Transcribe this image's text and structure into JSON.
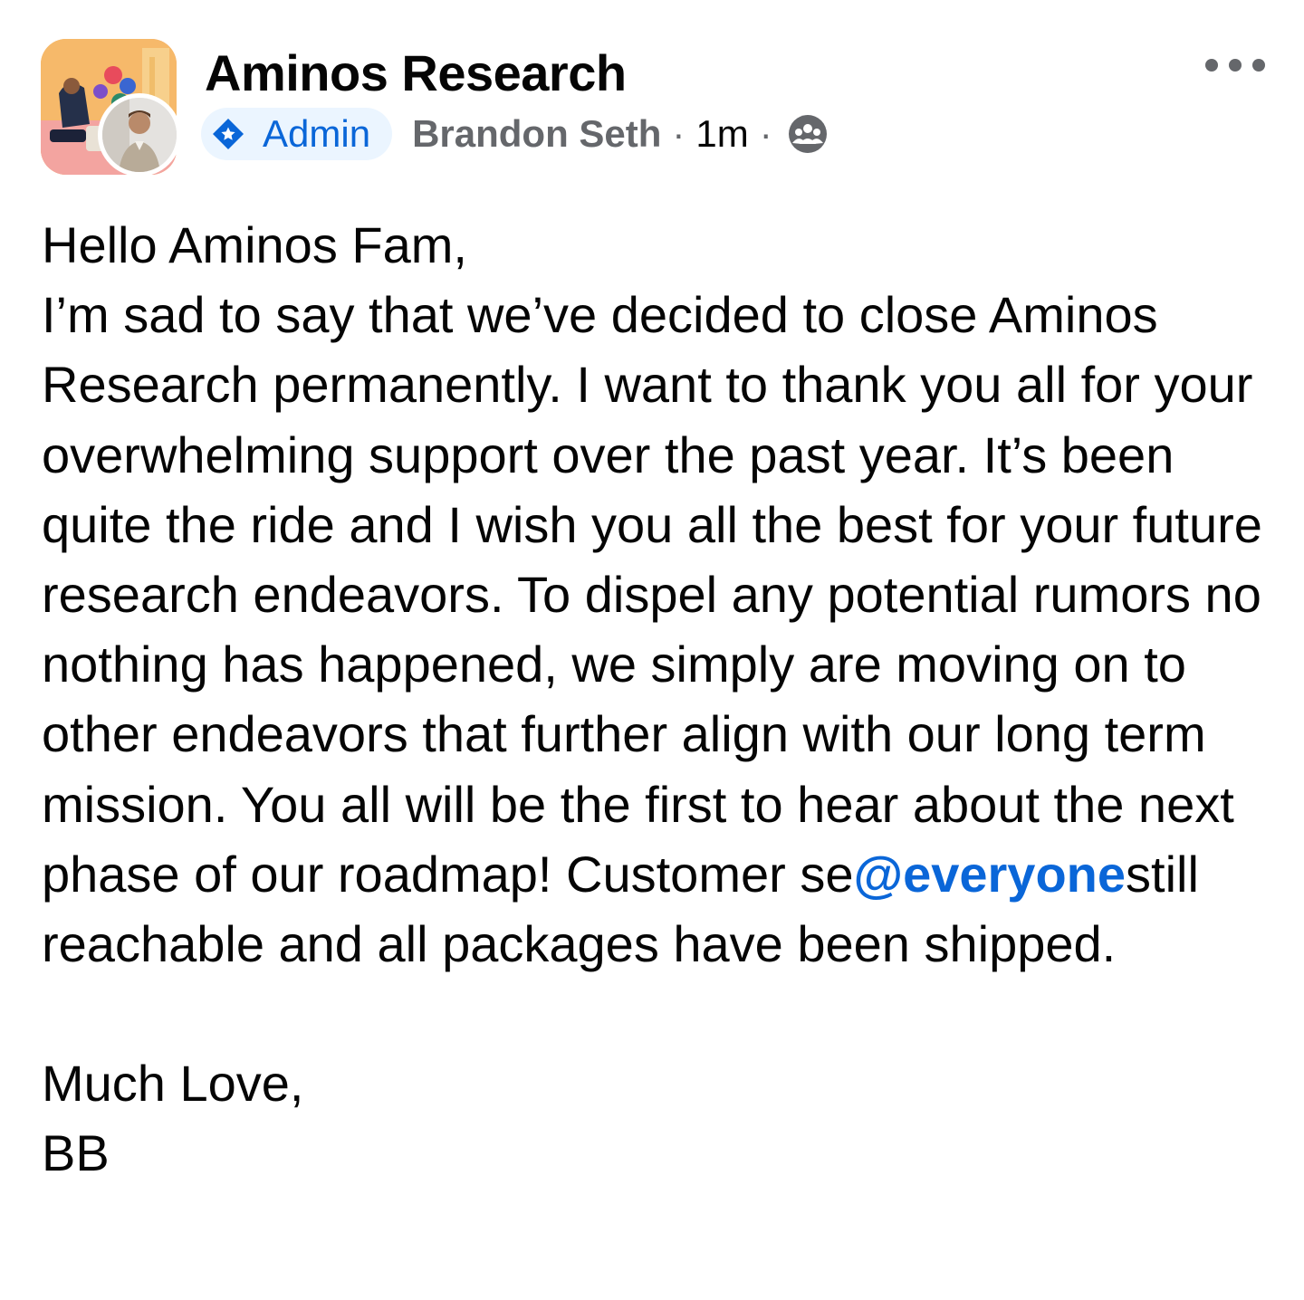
{
  "header": {
    "group_name": "Aminos Research",
    "role_badge": "Admin",
    "author": "Brandon Seth",
    "separator": "·",
    "time": "1m",
    "icons": {
      "badge": "admin-diamond-icon",
      "privacy": "group-members-icon",
      "more": "more-options-icon"
    }
  },
  "body": {
    "greeting": "Hello Aminos Fam,",
    "text_before_mention": "I’m sad to say that we’ve decided to close Aminos Research permanently. I want to thank you all for your overwhelming support over the past year. It’s been quite the ride and I wish you all the best for your future research endeavors. To dispel any potential rumors no nothing has happened, we simply are moving on to other endeavors that further align with our long term mission. You all will be the first to hear about the next phase of our roadmap! Customer se",
    "mention": "@everyone",
    "text_after_mention": "still reachable and all packages have been shipped.",
    "signoff": "Much Love,",
    "signature": "BB"
  },
  "colors": {
    "accent": "#0a66d8",
    "badge_bg": "#ebf5ff",
    "secondary_text": "#65676b",
    "primary_text": "#050505"
  }
}
